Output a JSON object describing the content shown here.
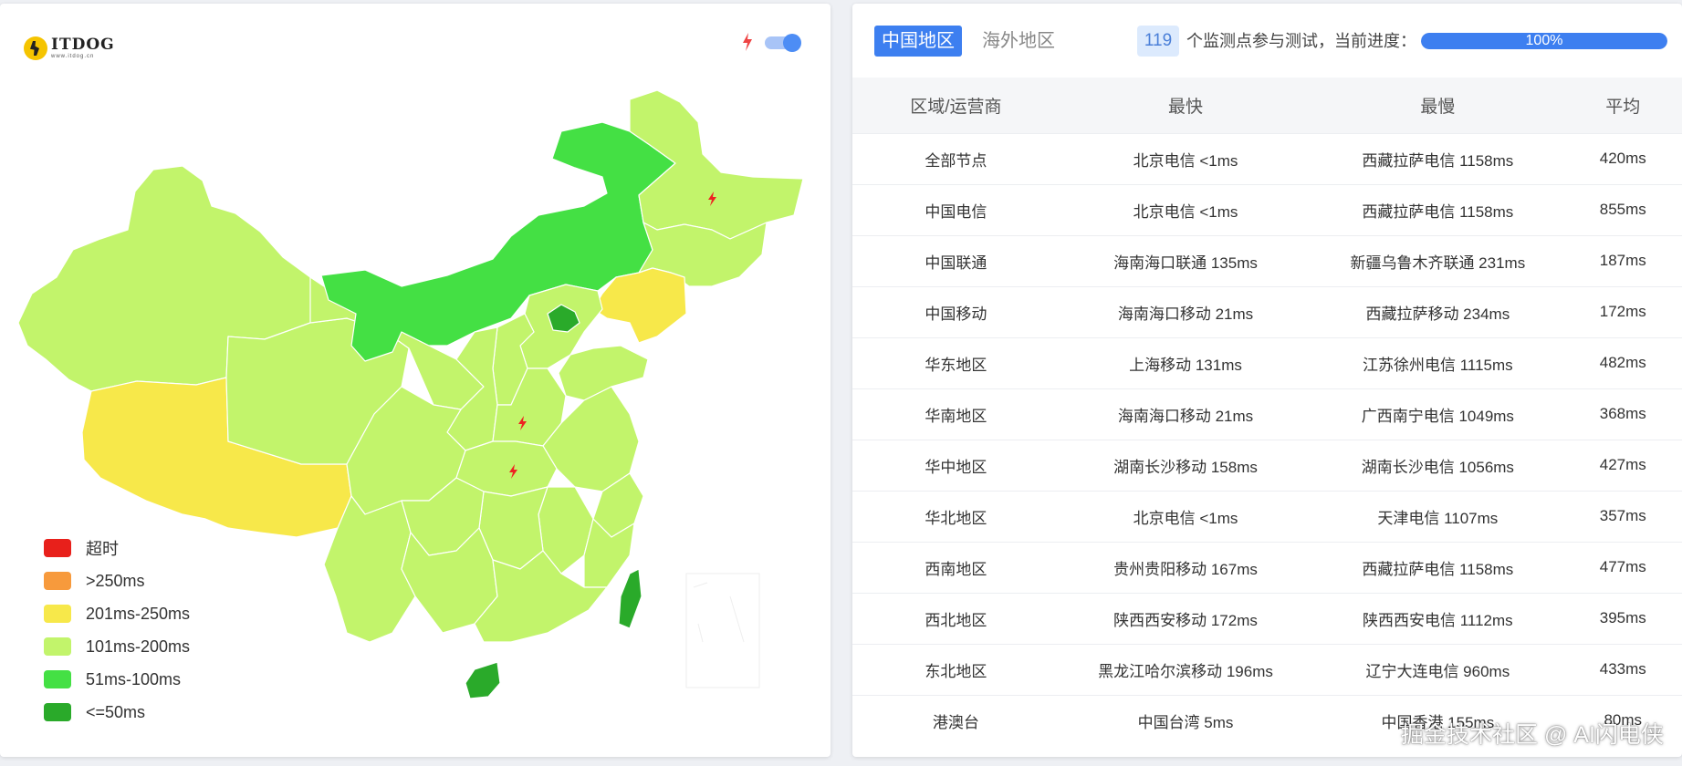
{
  "logo": {
    "name": "ITDOG",
    "sub": "www.itdog.cn"
  },
  "map": {
    "legend": [
      {
        "label": "超时",
        "color": "#e8201b"
      },
      {
        "label": ">250ms",
        "color": "#f79a3c"
      },
      {
        "label": "201ms-250ms",
        "color": "#f7e84a"
      },
      {
        "label": "101ms-200ms",
        "color": "#c2f46b"
      },
      {
        "label": "51ms-100ms",
        "color": "#44e044"
      },
      {
        "label": "<=50ms",
        "color": "#2aaa2a"
      }
    ],
    "toggle_on": true
  },
  "header": {
    "tab_cn": "中国地区",
    "tab_overseas": "海外地区",
    "node_count": "119",
    "progress_text": "个监测点参与测试，当前进度：",
    "progress_label": "100%",
    "progress_value": 100
  },
  "table": {
    "columns": [
      "区域/运营商",
      "最快",
      "最慢",
      "平均"
    ],
    "rows": [
      [
        "全部节点",
        "北京电信 <1ms",
        "西藏拉萨电信 1158ms",
        "420ms"
      ],
      [
        "中国电信",
        "北京电信 <1ms",
        "西藏拉萨电信 1158ms",
        "855ms"
      ],
      [
        "中国联通",
        "海南海口联通 135ms",
        "新疆乌鲁木齐联通 231ms",
        "187ms"
      ],
      [
        "中国移动",
        "海南海口移动 21ms",
        "西藏拉萨移动 234ms",
        "172ms"
      ],
      [
        "华东地区",
        "上海移动 131ms",
        "江苏徐州电信 1115ms",
        "482ms"
      ],
      [
        "华南地区",
        "海南海口移动 21ms",
        "广西南宁电信 1049ms",
        "368ms"
      ],
      [
        "华中地区",
        "湖南长沙移动 158ms",
        "湖南长沙电信 1056ms",
        "427ms"
      ],
      [
        "华北地区",
        "北京电信 <1ms",
        "天津电信 1107ms",
        "357ms"
      ],
      [
        "西南地区",
        "贵州贵阳移动 167ms",
        "西藏拉萨电信 1158ms",
        "477ms"
      ],
      [
        "西北地区",
        "陕西西安移动 172ms",
        "陕西西安电信 1112ms",
        "395ms"
      ],
      [
        "东北地区",
        "黑龙江哈尔滨移动 196ms",
        "辽宁大连电信 960ms",
        "433ms"
      ],
      [
        "港澳台",
        "中国台湾 5ms",
        "中国香港 155ms",
        "80ms"
      ]
    ]
  },
  "watermark": "掘金技术社区 @ AI闪电侠"
}
